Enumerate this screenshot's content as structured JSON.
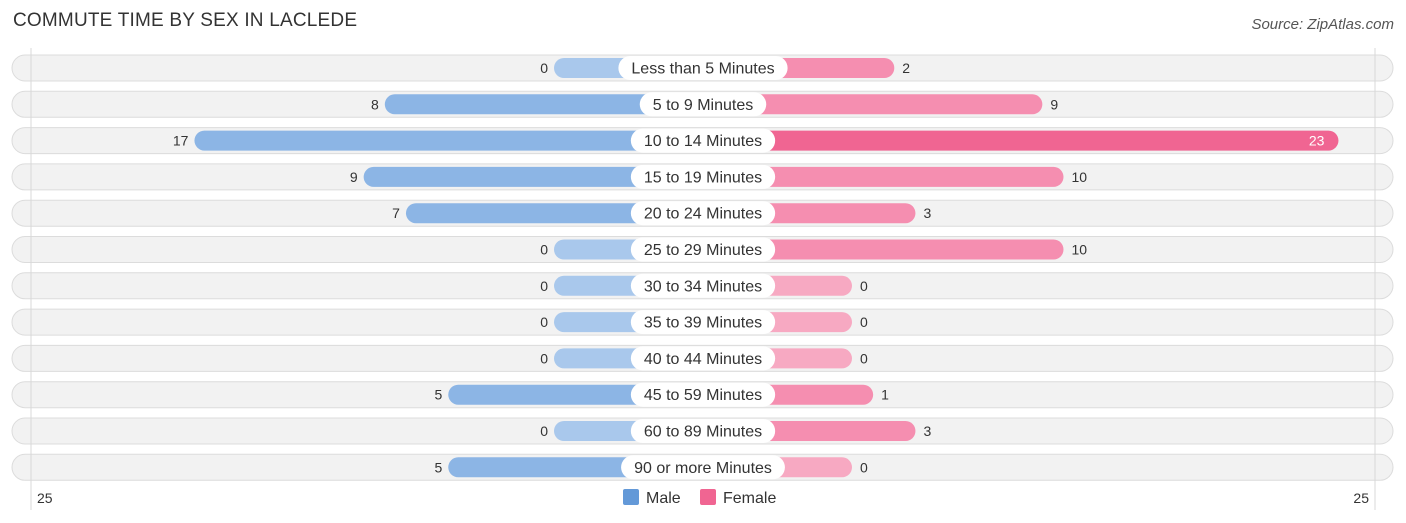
{
  "header": {
    "title": "COMMUTE TIME BY SEX IN LACLEDE",
    "source": "Source: ZipAtlas.com"
  },
  "chart_data": {
    "type": "bar",
    "orientation": "horizontal-diverging",
    "title": "COMMUTE TIME BY SEX IN LACLEDE",
    "categories": [
      "Less than 5 Minutes",
      "5 to 9 Minutes",
      "10 to 14 Minutes",
      "15 to 19 Minutes",
      "20 to 24 Minutes",
      "25 to 29 Minutes",
      "30 to 34 Minutes",
      "35 to 39 Minutes",
      "40 to 44 Minutes",
      "45 to 59 Minutes",
      "60 to 89 Minutes",
      "90 or more Minutes"
    ],
    "series": [
      {
        "name": "Male",
        "color": "#6a9fda",
        "values": [
          0,
          8,
          17,
          9,
          7,
          0,
          0,
          0,
          0,
          5,
          0,
          5
        ]
      },
      {
        "name": "Female",
        "color": "#f06592",
        "values": [
          2,
          9,
          23,
          10,
          3,
          10,
          0,
          0,
          0,
          1,
          3,
          0
        ]
      }
    ],
    "axis": {
      "left_label": "25",
      "right_label": "25",
      "max": 25
    },
    "legend": {
      "position": "bottom-center",
      "entries": [
        "Male",
        "Female"
      ]
    },
    "colors": {
      "male_light": "#a9c8ec",
      "male_mid": "#8cb5e5",
      "male_strong": "#6399d8",
      "female_light": "#f7a9c2",
      "female_mid": "#f58eb0",
      "female_strong": "#f06592"
    }
  }
}
